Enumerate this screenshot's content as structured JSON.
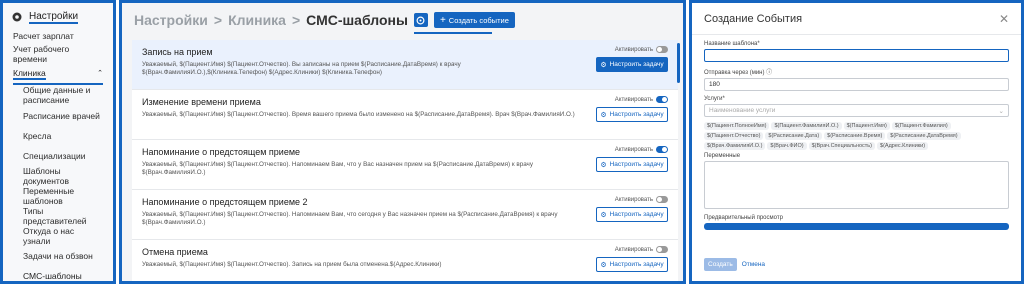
{
  "sidebar": {
    "settings_label": "Настройки",
    "items_top": [
      "Расчет зарплат",
      "Учет рабочего времени"
    ],
    "section_label": "Клиника",
    "sub_items": [
      "Общие данные и расписание",
      "Расписание врачей",
      "Кресла",
      "Специализации",
      "Шаблоны документов",
      "Переменные шаблонов",
      "Типы представителей",
      "Откуда о нас узнали",
      "Задачи на обзвон"
    ],
    "active_item": "СМС-шаблоны"
  },
  "header": {
    "crumb1": "Настройки",
    "crumb2": "Клиника",
    "crumb3": "СМС-шаблоны",
    "sep": ">",
    "create_label": "Создать событие"
  },
  "cards": [
    {
      "title": "Запись на прием",
      "text": "Уважаемый, $(Пациент.Имя) $(Пациент.Отчество). Вы записаны на прием $(Расписание.ДатаВремя) к врачу $(Врач.ФамилияИ.О.),$(Клиника.Телефон) $(Адрес.Клиники) $(Клиника.Телефон)",
      "toggle_label": "Активировать",
      "on": false,
      "button": "Настроить задачу",
      "filled": true,
      "active": true
    },
    {
      "title": "Изменение времени приема",
      "text": "Уважаемый, $(Пациент.Имя) $(Пациент.Отчество). Время вашего приема было изменено на $(Расписание.ДатаВремя). Врач $(Врач.ФамилияИ.О.)",
      "toggle_label": "Активировать",
      "on": true,
      "button": "Настроить задачу",
      "filled": false,
      "active": false
    },
    {
      "title": "Напоминание о предстоящем приеме",
      "text": "Уважаемый, $(Пациент.Имя) $(Пациент.Отчество). Напоминаем Вам, что у Вас назначен прием на $(Расписание.ДатаВремя) к врачу $(Врач.ФамилияИ.О.)",
      "toggle_label": "Активировать",
      "on": true,
      "button": "Настроить задачу",
      "filled": false,
      "active": false
    },
    {
      "title": "Напоминание о предстоящем приеме 2",
      "text": "Уважаемый, $(Пациент.Имя) $(Пациент.Отчество). Напоминаем Вам, что сегодня у Вас назначен прием на $(Расписание.ДатаВремя) к врачу $(Врач.ФамилияИ.О.)",
      "toggle_label": "Активировать",
      "on": false,
      "button": "Настроить задачу",
      "filled": false,
      "active": false
    },
    {
      "title": "Отмена приема",
      "text": "Уважаемый, $(Пациент.Имя) $(Пациент.Отчество). Запись на прием была отменена.$(Адрес.Клиники)",
      "toggle_label": "Активировать",
      "on": false,
      "button": "Настроить задачу",
      "filled": false,
      "active": false
    }
  ],
  "modal": {
    "title": "Создание События",
    "name_label": "Название шаблона*",
    "name_value": "",
    "send_label": "Отправка через (мин)",
    "send_value": "180",
    "services_label": "Услуги*",
    "services_placeholder": "Наименование услуги",
    "chips": [
      "$(Пациент.ПолноеИмя)",
      "$(Пациент.ФамилияИ.О.)",
      "$(Пациент.Имя)",
      "$(Пациент.Фамилия)",
      "$(Пациент.Отчество)",
      "$(Расписание.Дата)",
      "$(Расписание.Время)",
      "$(Расписание.ДатаВремя)",
      "$(Врач.ФамилияИ.О.)",
      "$(Врач.ФИО)",
      "$(Врач.Специальность)",
      "$(Адрес.Клиники)"
    ],
    "variables_label": "Переменные",
    "preview_label": "Предварительный просмотр",
    "save_label": "Создать",
    "cancel_label": "Отмена"
  },
  "colors": {
    "accent": "#1565c0"
  }
}
